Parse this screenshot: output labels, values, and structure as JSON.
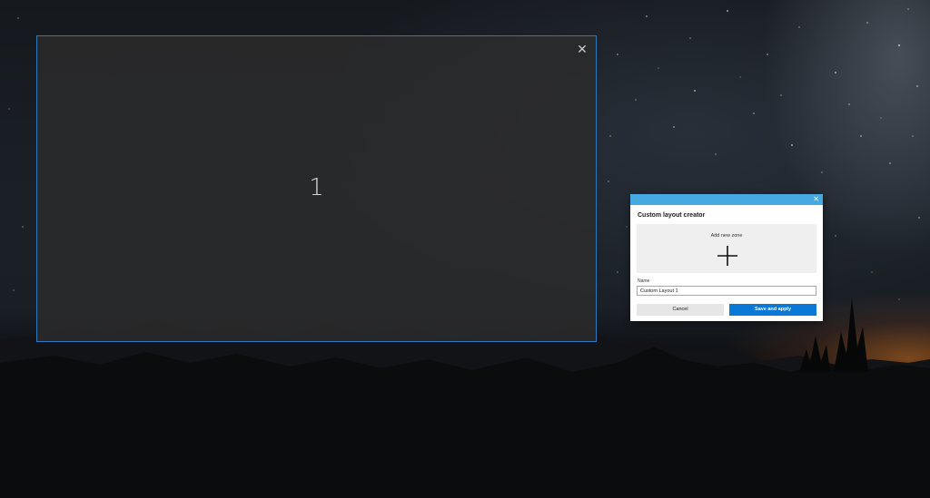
{
  "zone_editor": {
    "zone_number": "1",
    "close_icon": "close-icon"
  },
  "dialog": {
    "title": "Custom layout creator",
    "add_zone_label": "Add new zone",
    "add_zone_icon": "plus-icon",
    "name_label": "Name",
    "name_value": "Custom Layout 1",
    "cancel_label": "Cancel",
    "save_label": "Save and apply",
    "accent_color": "#47a9e2",
    "primary_button_color": "#0a78d7"
  }
}
